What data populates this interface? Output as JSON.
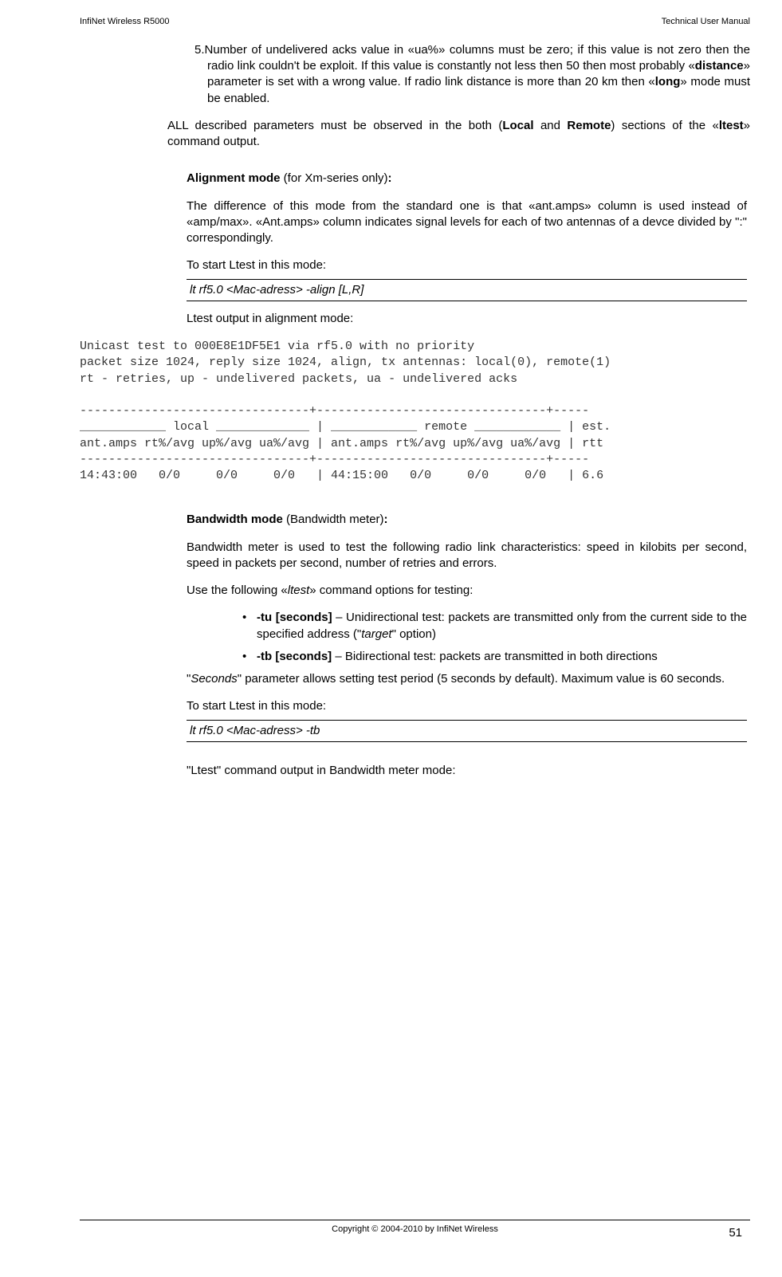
{
  "header": {
    "left": "InfiNet Wireless R5000",
    "right": "Technical User Manual"
  },
  "para1_pre": "5.",
  "para1": "Number of undelivered acks value in «ua%» columns must be zero; if this value is not zero then the radio link couldn't be exploit. If this value is constantly not less then 50 then most probably «",
  "para1_b1": "distance",
  "para1_mid": "» parameter is set with a wrong value. If radio link distance is more than 20 km then «",
  "para1_b2": "long",
  "para1_end": "» mode must be enabled.",
  "para2_pre": "ALL described parameters must be observed in the both (",
  "para2_b1": "Local",
  "para2_mid": " and ",
  "para2_b2": "Remote",
  "para2_mid2": ") sections of the «",
  "para2_b3": "ltest",
  "para2_end": "» command output.",
  "align_title": "Alignment mode",
  "align_title_suffix": " (for Xm-series only)",
  "align_colon": ":",
  "align_p1": "The difference of this mode from the standard one is that «ant.amps» column is used instead of «amp/max». «Ant.amps» column indicates signal levels for each of two antennas of a devce divided by \":\" correspondingly.",
  "align_p2": " To start Ltest in this mode:",
  "cmd1": "lt rf5.0 <Mac-adress> -align [L,R]",
  "align_p3": "Ltest output in alignment mode:",
  "terminal": "Unicast test to 000E8E1DF5E1 via rf5.0 with no priority\npacket size 1024, reply size 1024, align, tx antennas: local(0), remote(1)\nrt - retries, up - undelivered packets, ua - undelivered acks\n\n--------------------------------+--------------------------------+-----\n____________ local _____________ | ____________ remote ____________ | est.\nant.amps rt%/avg up%/avg ua%/avg | ant.amps rt%/avg up%/avg ua%/avg | rtt\n--------------------------------+--------------------------------+-----\n14:43:00   0/0     0/0     0/0   | 44:15:00   0/0     0/0     0/0   | 6.6",
  "bw_title": "Bandwidth mode",
  "bw_title_suffix": " (Bandwidth meter)",
  "bw_colon": ":",
  "bw_p1": "Bandwidth meter is used to test the following radio link characteristics: speed in kilobits per second, speed in packets per second, number of retries and errors.",
  "bw_p2_pre": "Use the following «",
  "bw_p2_i": "ltest",
  "bw_p2_end": "» command options for testing:",
  "bullet1_b": "-tu [seconds]",
  "bullet1_txt": " – Unidirectional test: packets are transmitted only from the current side to the specified address (\"",
  "bullet1_i": "target",
  "bullet1_end": "\" option)",
  "bullet2_b": "-tb [seconds]",
  "bullet2_txt": " – Bidirectional test: packets are transmitted in both directions",
  "bw_p3_pre": "\"",
  "bw_p3_i": "Seconds",
  "bw_p3_end": "\" parameter allows setting test period (5 seconds by default). Maximum value is 60 seconds.",
  "bw_p4": "To start Ltest in this mode:",
  "cmd2": "lt rf5.0 <Mac-adress> -tb",
  "bw_p5": "\"Ltest\" command output in Bandwidth meter mode:",
  "footer": {
    "copyright": "Copyright © 2004-2010 by InfiNet Wireless",
    "page": "51"
  }
}
